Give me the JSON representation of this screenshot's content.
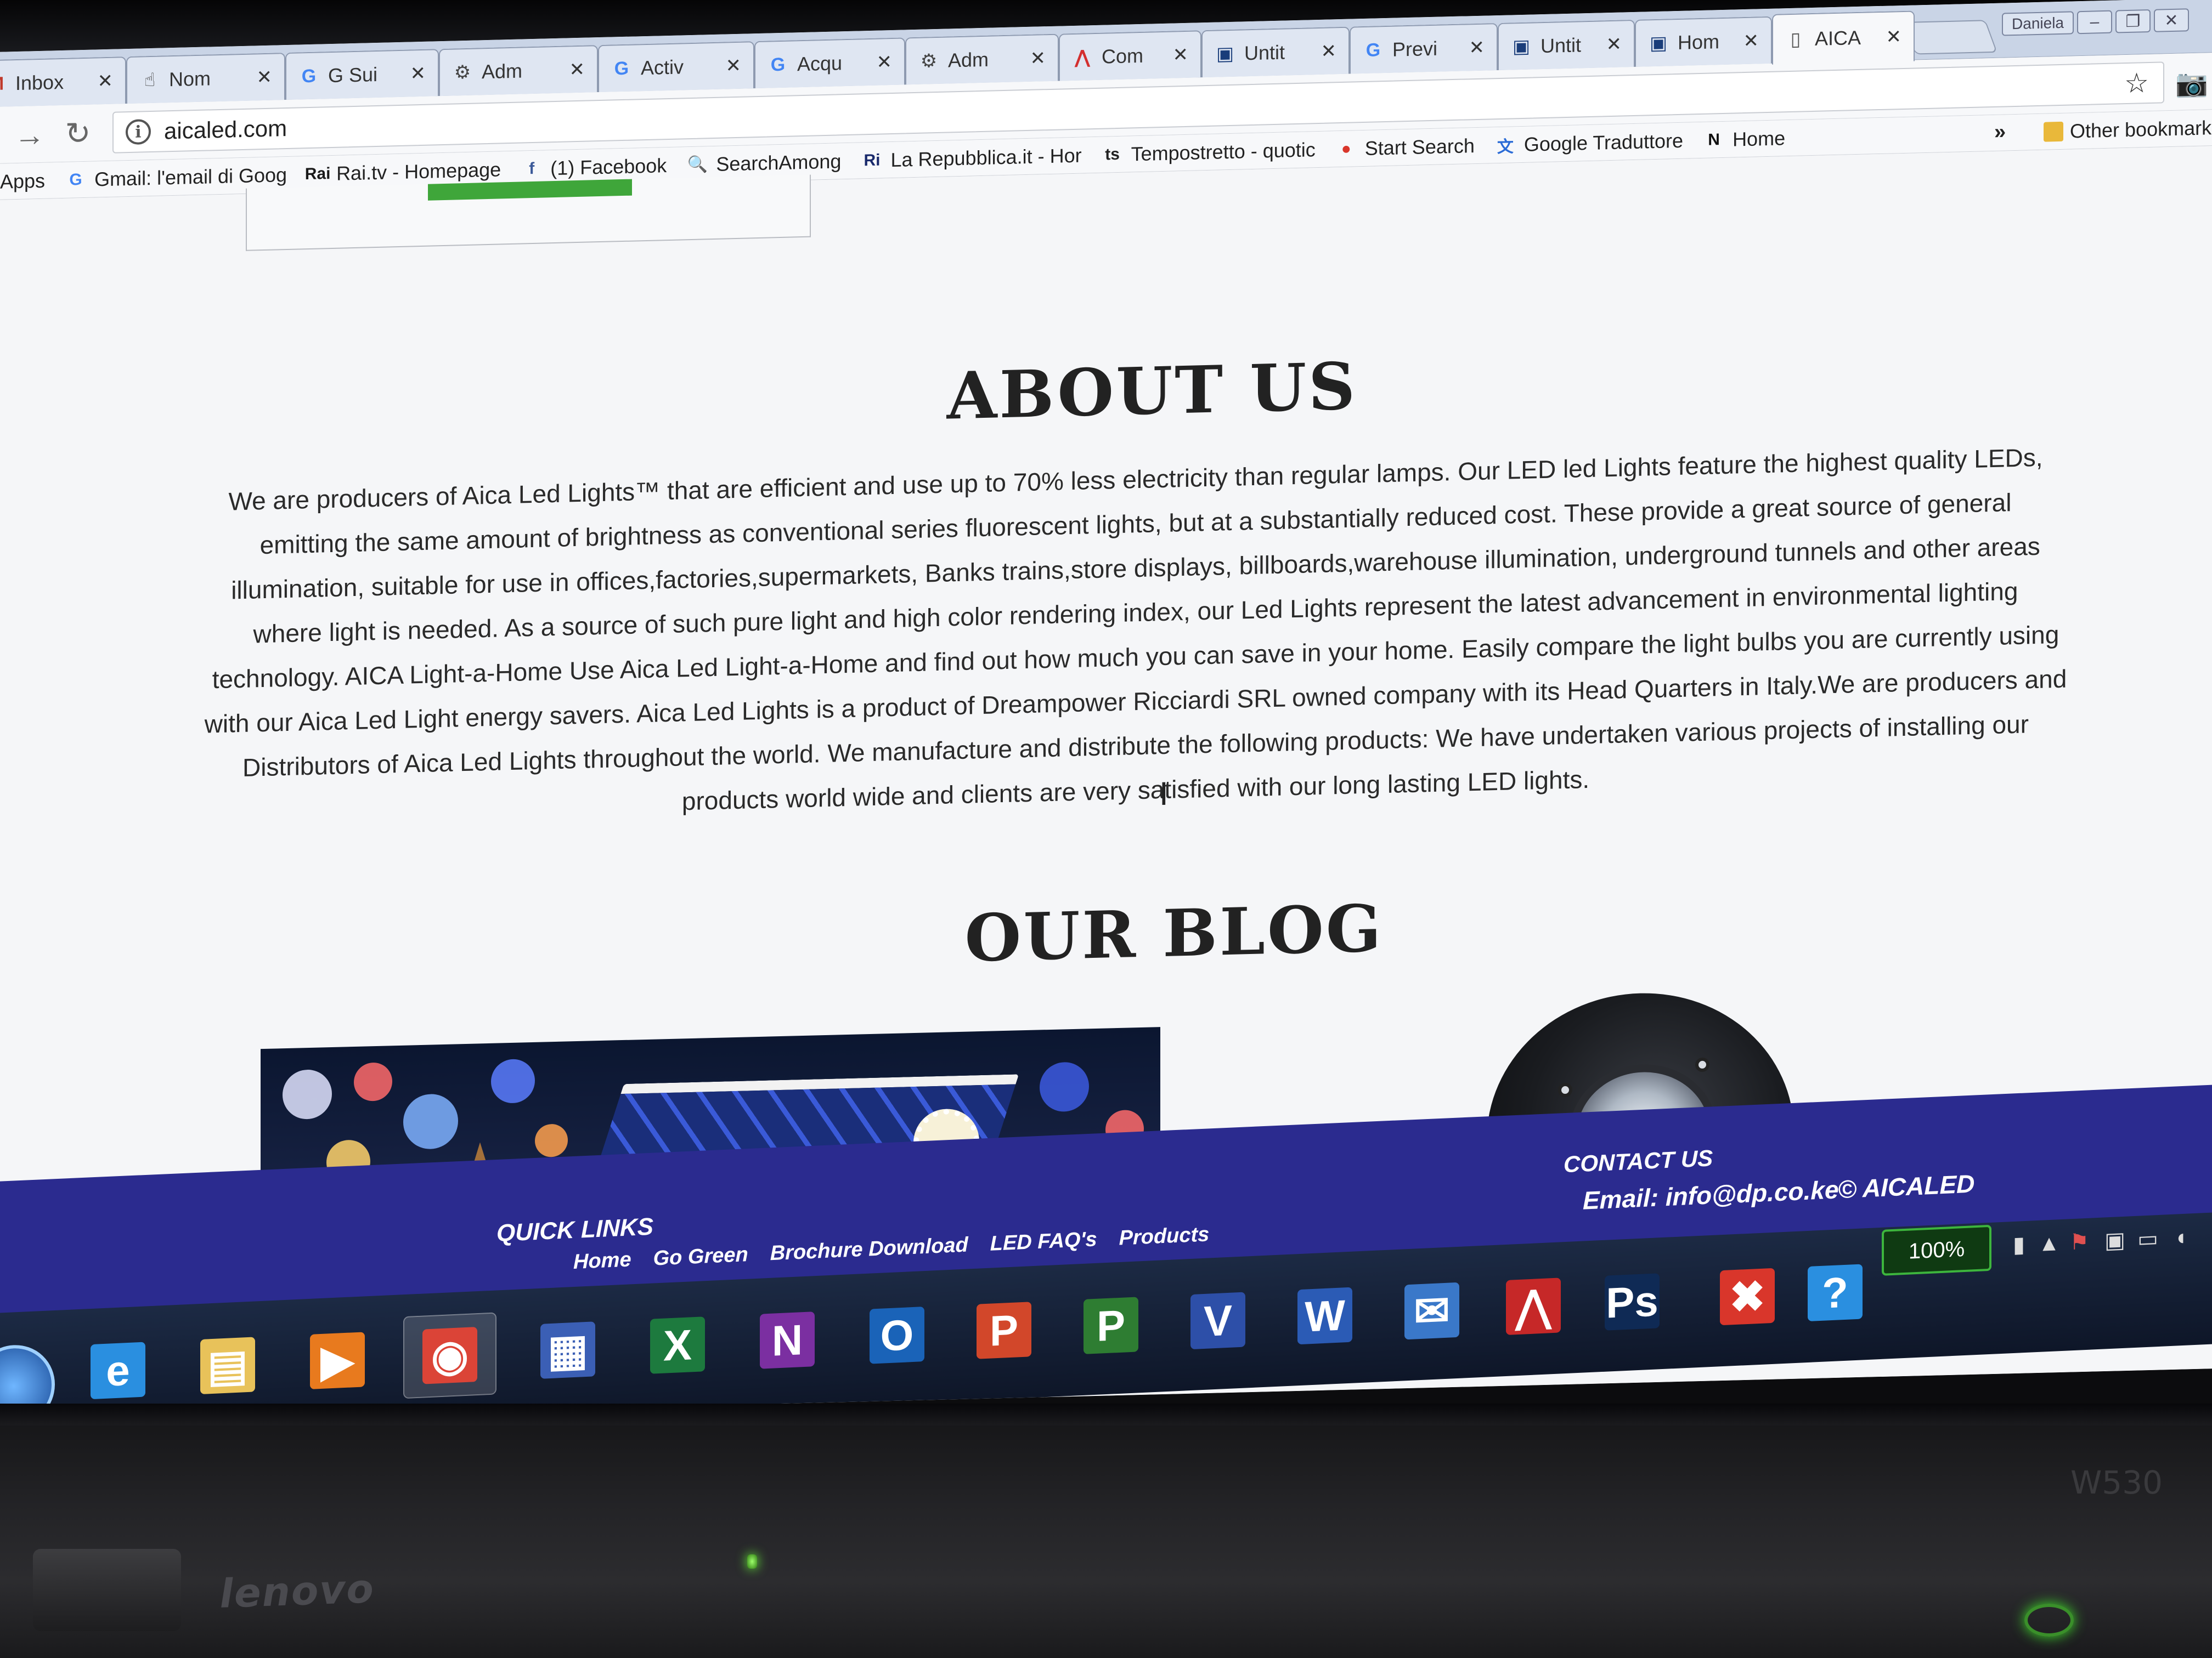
{
  "browser": {
    "tabs": [
      {
        "label": "Inbox",
        "icon": "gmail-icon",
        "glyph": "M",
        "color": "#c0392b"
      },
      {
        "label": "Nom",
        "icon": "hand-pointer-icon",
        "glyph": "☝",
        "color": "#444"
      },
      {
        "label": "G Sui",
        "icon": "google-icon",
        "glyph": "G",
        "color": "#4285f4"
      },
      {
        "label": "Adm",
        "icon": "admin-gear-icon",
        "glyph": "⚙",
        "color": "#444"
      },
      {
        "label": "Activ",
        "icon": "google-icon",
        "glyph": "G",
        "color": "#4285f4"
      },
      {
        "label": "Acqu",
        "icon": "google-icon",
        "glyph": "G",
        "color": "#4285f4"
      },
      {
        "label": "Adm",
        "icon": "admin-gear-icon",
        "glyph": "⚙",
        "color": "#444"
      },
      {
        "label": "Com",
        "icon": "acrobat-icon",
        "glyph": "⋀",
        "color": "#d32f2f"
      },
      {
        "label": "Untit",
        "icon": "window-icon",
        "glyph": "▣",
        "color": "#1a3d7a"
      },
      {
        "label": "Previ",
        "icon": "google-icon",
        "glyph": "G",
        "color": "#4285f4"
      },
      {
        "label": "Untit",
        "icon": "window-icon",
        "glyph": "▣",
        "color": "#1a3d7a"
      },
      {
        "label": "Hom",
        "icon": "window-icon",
        "glyph": "▣",
        "color": "#1a3d7a"
      },
      {
        "label": "AICA",
        "icon": "page-icon",
        "glyph": "▯",
        "color": "#555",
        "active": true
      }
    ],
    "close_glyph": "✕",
    "user_chip": "Daniela",
    "minimize": "–",
    "restore": "❐",
    "close": "✕",
    "url": "aicaled.com",
    "info_glyph": "i",
    "star_glyph": "☆",
    "camera_glyph": "📷",
    "back_glyph": "→",
    "reload_glyph": "↻",
    "bookmarks": [
      {
        "label": "Apps",
        "icon": "",
        "glyph": "",
        "color": "#444"
      },
      {
        "label": "Gmail: l'email di Goog",
        "icon": "google-icon",
        "glyph": "G",
        "color": "#4285f4"
      },
      {
        "label": "Rai.tv - Homepage",
        "icon": "rai-icon",
        "glyph": "Rai",
        "color": "#1a1a1a"
      },
      {
        "label": "(1) Facebook",
        "icon": "facebook-icon",
        "glyph": "f",
        "color": "#3b5998"
      },
      {
        "label": "SearchAmong",
        "icon": "magnifier-icon",
        "glyph": "🔍",
        "color": "#2a6bd6"
      },
      {
        "label": "La Repubblica.it - Hor",
        "icon": "repubblica-icon",
        "glyph": "Ri",
        "color": "#1a2a6c"
      },
      {
        "label": "Tempostretto - quotic",
        "icon": "tempostretto-icon",
        "glyph": "ts",
        "color": "#222"
      },
      {
        "label": "Start Search",
        "icon": "speech-bubble-icon",
        "glyph": "●",
        "color": "#d9362b"
      },
      {
        "label": "Google Traduttore",
        "icon": "translate-icon",
        "glyph": "文",
        "color": "#2a6bd6"
      },
      {
        "label": "Home",
        "icon": "notion-icon",
        "glyph": "N",
        "color": "#111"
      }
    ],
    "more_glyph": "»",
    "other_bookmarks": "Other bookmark"
  },
  "page": {
    "about": {
      "title": "ABOUT US",
      "body": "We are producers of Aica Led Lights™ that are efficient and use up to 70% less electricity than regular lamps. Our LED led Lights feature the highest quality LEDs, emitting the same amount of brightness as conventional series fluorescent lights, but at a substantially reduced cost. These provide a great source of general illumination, suitable for use in offices,factories,supermarkets, Banks trains,store displays, billboards,warehouse illumination, underground tunnels and other areas where light is needed. As a source of such pure light and high color rendering index, our Led Lights represent the latest advancement in environmental lighting technology. AICA Light-a-Home Use Aica Led Light-a-Home and find out how much you can save in your home. Easily compare the light bulbs you are currently using with our Aica Led Light energy savers. Aica Led Lights is a product of Dreampower Ricciardi SRL owned company with its Head Quarters in Italy.We are producers and Distributors of Aica Led Lights throughout the world. We manufacture and distribute the following products: We have undertaken various projects of installing our products world wide and clients are very satisfied with our long lasting LED lights."
    },
    "blog": {
      "title": "OUR BLOG"
    },
    "footer": {
      "quick_links_title": "QUICK LINKS",
      "links": [
        "Home",
        "Go Green",
        "Brochure Download",
        "LED FAQ's",
        "Products"
      ],
      "contact_title": "CONTACT US",
      "email": "Email: info@dp.co.ke",
      "copyright": "© AICALED"
    }
  },
  "taskbar": {
    "apps": [
      {
        "name": "internet-explorer-icon",
        "glyph": "e",
        "color": "#2a8fe0"
      },
      {
        "name": "file-explorer-icon",
        "glyph": "▤",
        "color": "#e8c25a"
      },
      {
        "name": "media-player-icon",
        "glyph": "▶",
        "color": "#e87a1e"
      },
      {
        "name": "chrome-icon",
        "glyph": "◉",
        "color": "#db4437",
        "active": true
      },
      {
        "name": "calendar-app-icon",
        "glyph": "▦",
        "color": "#3b5fb5"
      },
      {
        "name": "excel-icon",
        "glyph": "X",
        "color": "#1d7a3e"
      },
      {
        "name": "onenote-icon",
        "glyph": "N",
        "color": "#7b2fa1"
      },
      {
        "name": "outlook-icon",
        "glyph": "O",
        "color": "#1a63b8"
      },
      {
        "name": "powerpoint-icon",
        "glyph": "P",
        "color": "#d2472a"
      },
      {
        "name": "project-icon",
        "glyph": "P",
        "color": "#2e7d32"
      },
      {
        "name": "visio-icon",
        "glyph": "V",
        "color": "#2d4fa8"
      },
      {
        "name": "word-icon",
        "glyph": "W",
        "color": "#2b5bb5"
      },
      {
        "name": "thunderbird-icon",
        "glyph": "✉",
        "color": "#3a78c9"
      },
      {
        "name": "acrobat-icon",
        "glyph": "⋀",
        "color": "#c62828"
      },
      {
        "name": "photoshop-icon",
        "glyph": "Ps",
        "color": "#0f2a55"
      },
      {
        "name": "office-error-icon",
        "glyph": "✖",
        "color": "#d9362b"
      },
      {
        "name": "help-icon",
        "glyph": "?",
        "color": "#2a8fe0"
      }
    ],
    "battery": "100%"
  }
}
